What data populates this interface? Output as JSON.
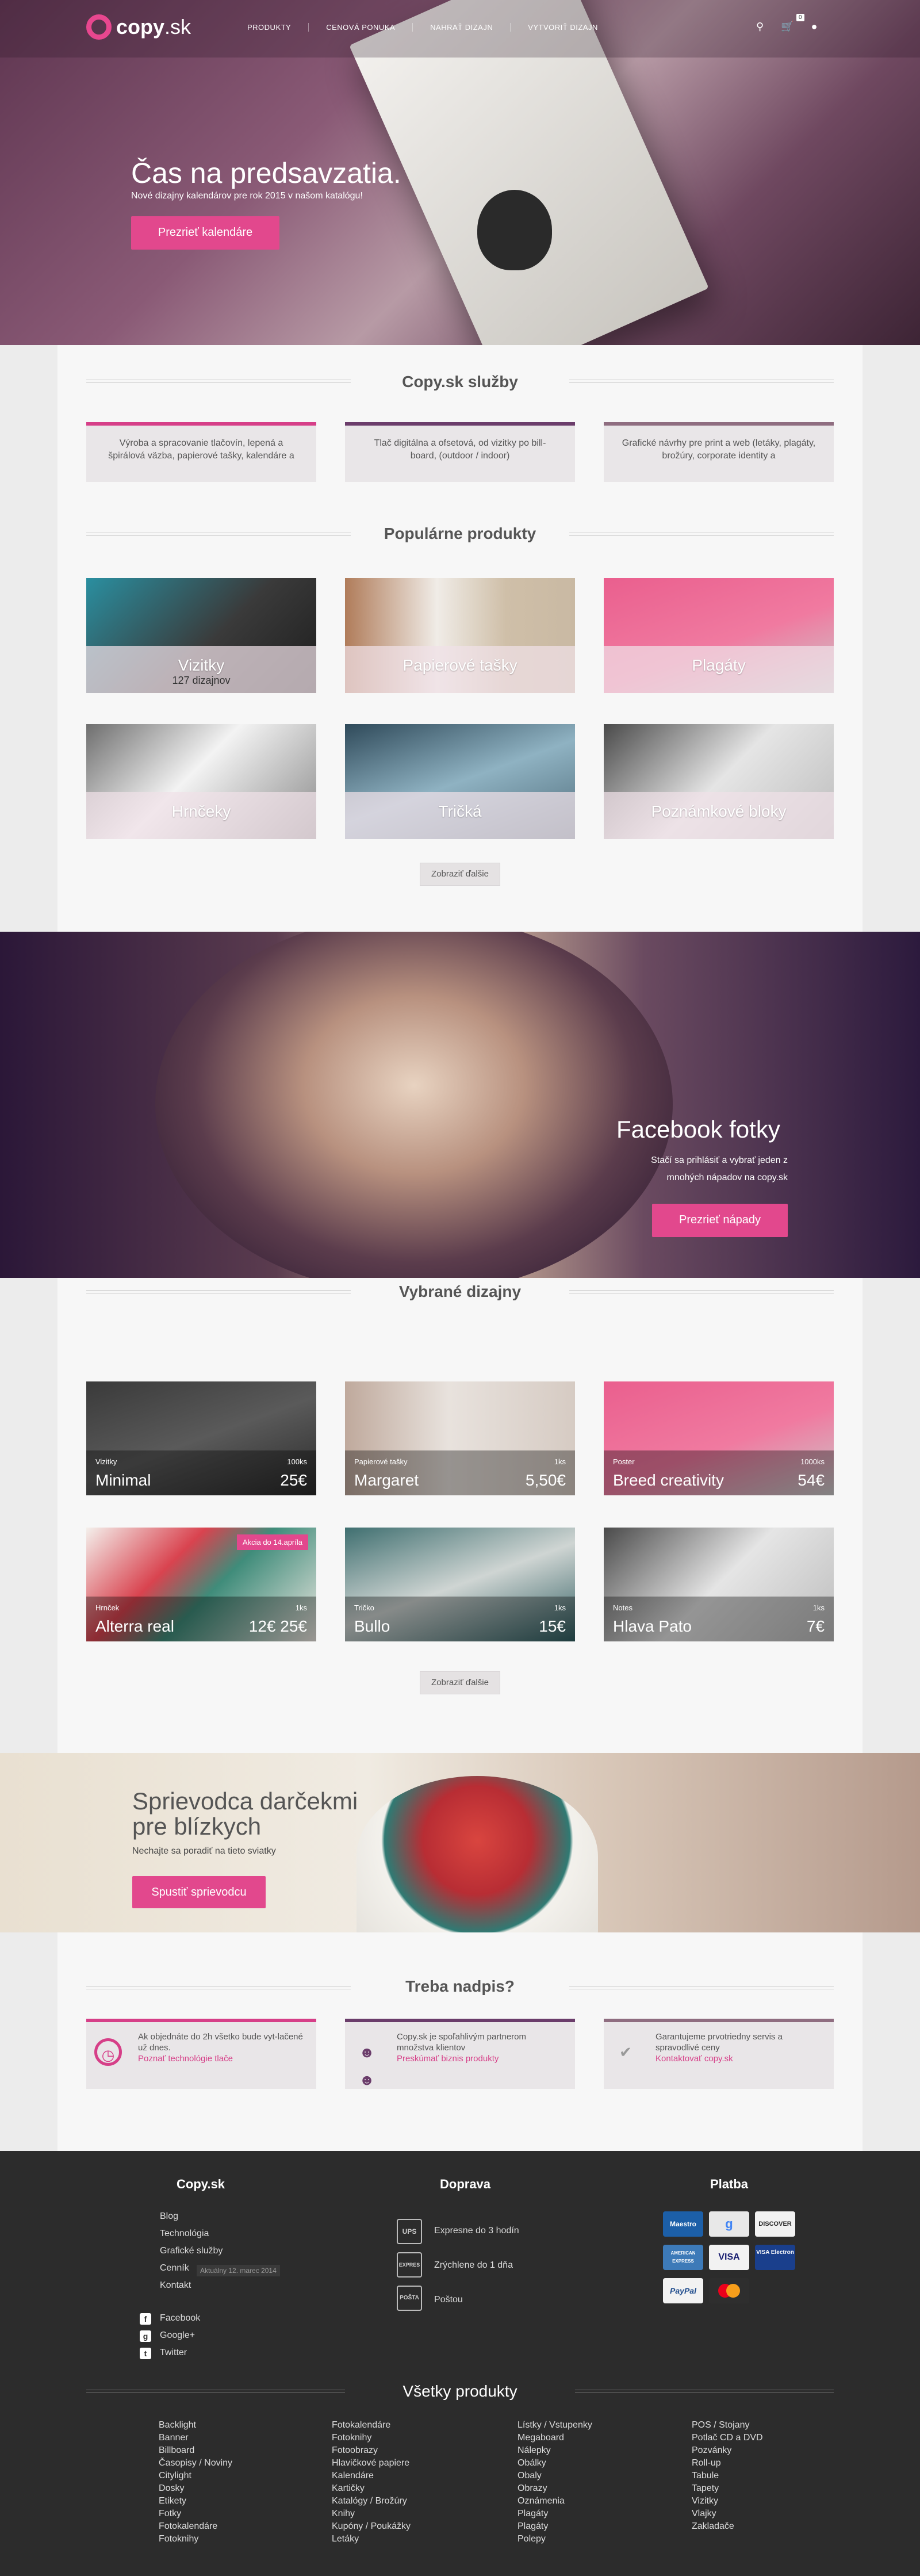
{
  "header": {
    "logo_main": "copy",
    "logo_suffix": ".sk",
    "menu": [
      "PRODUKTY",
      "CENOVÁ PONUKA",
      "NAHRAŤ DIZAJN",
      "VYTVORIŤ DIZAJN"
    ],
    "cart_count": "0",
    "icons": [
      "search-icon",
      "cart-icon",
      "user-icon"
    ]
  },
  "hero": {
    "title": "Čas na predsavzatia.",
    "subtitle": "Nové dizajny kalendárov pre rok 2015 v našom katalógu!",
    "button": "Prezrieť kalendáre"
  },
  "services": {
    "title": "Copy.sk služby",
    "items": [
      "Výroba a spracovanie tlačovín, lepená a špirálová väzba, papierové tašky, kalendáre a",
      "Tlač digitálna a ofsetová, od vizitky po bill-board, (outdoor / indoor)",
      "Grafické návrhy pre print a web (letáky, plagáty, brožúry, corporate identity a"
    ]
  },
  "popular": {
    "title": "Populárne produkty",
    "items": [
      {
        "label": "Vizitky",
        "count": "127 dizajnov"
      },
      {
        "label": "Papierové tašky",
        "count": ""
      },
      {
        "label": "Plagáty",
        "count": ""
      },
      {
        "label": "Hrnčeky",
        "count": ""
      },
      {
        "label": "Tričká",
        "count": ""
      },
      {
        "label": "Poznámkové bloky",
        "count": ""
      }
    ],
    "more": "Zobraziť ďalšie"
  },
  "facebook": {
    "title": "Facebook fotky",
    "text1": "Stačí sa prihlásiť a vybrať jeden z",
    "text2": "mnohých nápadov na copy.sk",
    "button": "Prezrieť nápady"
  },
  "featured": {
    "title": "Vybrané dizajny",
    "items": [
      {
        "category": "Vizitky",
        "name": "Minimal",
        "qty": "100ks",
        "price": "25€"
      },
      {
        "category": "Papierové tašky",
        "name": "Margaret",
        "qty": "1ks",
        "price": "5,50€"
      },
      {
        "category": "Poster",
        "name": "Breed creativity",
        "qty": "1000ks",
        "price": "54€"
      },
      {
        "category": "Hrnček",
        "name": "Alterra real",
        "qty": "1ks",
        "price": "12€ 25€",
        "badge": "Akcia do 14.apríla"
      },
      {
        "category": "Tričko",
        "name": "Bullo",
        "qty": "1ks",
        "price": "15€"
      },
      {
        "category": "Notes",
        "name": "Hlava Pato",
        "qty": "1ks",
        "price": "7€"
      }
    ],
    "more": "Zobraziť ďalšie"
  },
  "promo": {
    "title_line1": "Sprievodca darčekmi",
    "title_line2": "pre blízkych",
    "subtitle": "Nechajte sa poradiť na tieto sviatky",
    "button": "Spustiť sprievodcu"
  },
  "info": {
    "title": "Treba nadpis?",
    "items": [
      {
        "icon": "clock-icon",
        "text": "Ak objednáte do 2h všetko bude vyt-lačené už dnes.",
        "link": "Poznať technológie tlače"
      },
      {
        "icon": "people-icon",
        "text": "Copy.sk je spoľahlivým partnerom množstva klientov",
        "link": "Preskúmať biznis produkty"
      },
      {
        "icon": "thumbs-up-icon",
        "text": "Garantujeme prvotriedny servis a spravodlivé ceny",
        "link": "Kontaktovať copy.sk"
      }
    ]
  },
  "footer": {
    "col1_title": "Copy.sk",
    "col1_links": [
      "Blog",
      "Technológia",
      "Grafické služby",
      "Cenník",
      "Kontakt"
    ],
    "price_date": "Aktuálny 12. marec 2014",
    "social": [
      "Facebook",
      "Google+",
      "Twitter"
    ],
    "col2_title": "Doprava",
    "shipping": [
      {
        "icon": "ups-icon",
        "label": "Expresne do 3 hodín"
      },
      {
        "icon": "expres-icon",
        "label": "Zrýchlene do 1 dňa"
      },
      {
        "icon": "posta-icon",
        "label": "Poštou"
      }
    ],
    "col3_title": "Platba",
    "payments": [
      "Maestro",
      "Google",
      "DISCOVER",
      "AMERICAN EXPRESS",
      "VISA",
      "VISA Electron",
      "PayPal",
      "MasterCard"
    ],
    "all_title": "Všetky produkty",
    "all_products": [
      [
        "Backlight",
        "Banner",
        "Billboard",
        "Časopisy / Noviny",
        "Citylight",
        "Dosky",
        "Etikety",
        "Fotky",
        "Fotokalendáre",
        "Fotoknihy"
      ],
      [
        "Fotokalendáre",
        "Fotoknihy",
        "Fotoobrazy",
        "Hlavičkové papiere",
        "Kalendáre",
        "Kartičky",
        "Katalógy / Brožúry",
        "Knihy",
        "Kupóny / Poukážky",
        "Letáky"
      ],
      [
        "Lístky / Vstupenky",
        "Megaboard",
        "Nálepky",
        "Obálky",
        "Obaly",
        "Obrazy",
        "Oznámenia",
        "Plagáty",
        "Plagáty",
        "Polepy"
      ],
      [
        "POS / Stojany",
        "Potlač CD a DVD",
        "Pozvánky",
        "Roll-up",
        "Tabule",
        "Tapety",
        "Vizitky",
        "Vlajky",
        "Zakladače"
      ]
    ]
  }
}
